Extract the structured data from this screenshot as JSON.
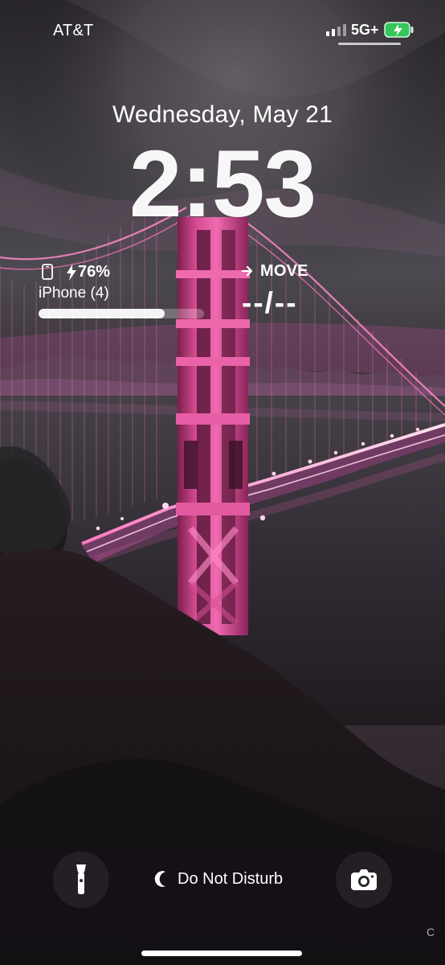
{
  "status_bar": {
    "carrier": "AT&T",
    "network": "5G+",
    "signal_icon": "signal-bars-icon",
    "battery_icon": "charging-battery-icon",
    "battery_color": "#34c759"
  },
  "lock_screen": {
    "date": "Wednesday, May 21",
    "time": "2:53"
  },
  "widgets": {
    "battery": {
      "icon": "phone-icon",
      "charging_icon": "bolt-icon",
      "percent": "76%",
      "device": "iPhone (4)",
      "level": 0.76
    },
    "activity": {
      "icon": "arrow-right-icon",
      "label": "MOVE",
      "value": "--/--"
    }
  },
  "controls": {
    "flashlight": {
      "icon": "flashlight-icon"
    },
    "focus": {
      "icon": "moon-icon",
      "label": "Do Not Disturb"
    },
    "camera": {
      "icon": "camera-icon"
    }
  },
  "edge_text": "C",
  "colors": {
    "wallpaper_sky": "#2a2328",
    "wallpaper_pink": "#c73b85",
    "button_background": "#282226"
  }
}
